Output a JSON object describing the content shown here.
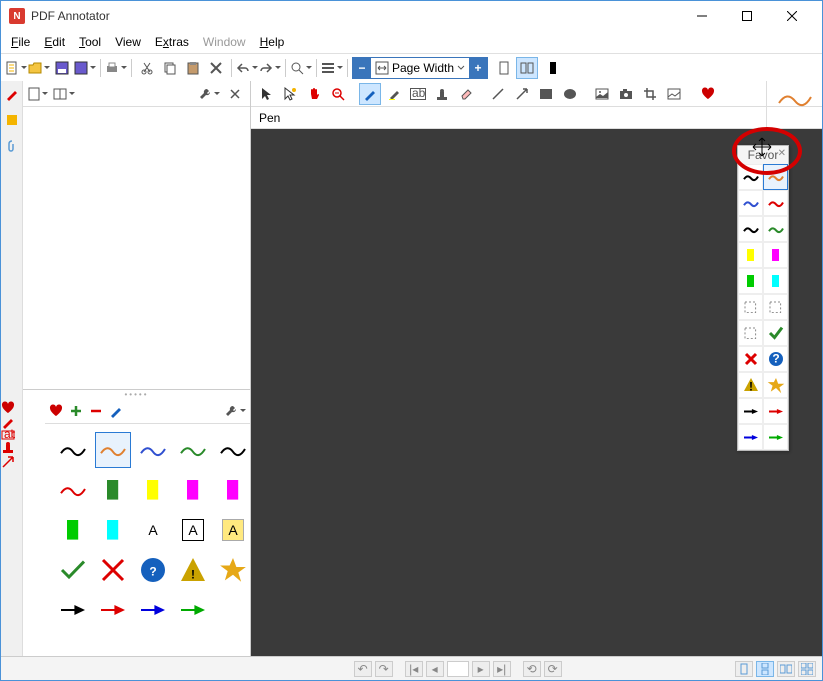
{
  "window": {
    "title": "PDF Annotator",
    "app_abbrev": "N"
  },
  "menu": {
    "file": "File",
    "file_u": "F",
    "edit": "Edit",
    "edit_u": "E",
    "tool": "Tool",
    "tool_u": "T",
    "view": "View",
    "view_u": "V",
    "extras": "Extras",
    "extras_u": "x",
    "window": "Window",
    "window_u": "W",
    "help": "Help",
    "help_u": "H"
  },
  "zoom": {
    "label": "Page Width"
  },
  "tooltabs": {
    "current_label": "Pen"
  },
  "favorites_panel": {
    "title": "Favor"
  },
  "left_tabs": {
    "items": [
      {
        "name": "marker",
        "color": "#d40000"
      },
      {
        "name": "note",
        "color": "#f4b400"
      },
      {
        "name": "attach",
        "color": "#5a9bd5"
      }
    ]
  },
  "fav_hdr": {
    "icons": [
      "heart",
      "plus",
      "minus",
      "pencil"
    ]
  },
  "fav_grid_items": [
    {
      "t": "sq",
      "c": "#000"
    },
    {
      "t": "sq",
      "c": "#e08030",
      "sel": true
    },
    {
      "t": "sq",
      "c": "#3050d0"
    },
    {
      "t": "sq",
      "c": "#2a8a2a"
    },
    {
      "t": "sq",
      "c": "#000"
    },
    {
      "t": "sq",
      "c": "#d00"
    },
    {
      "t": "hl",
      "c": "#2a8a2a"
    },
    {
      "t": "hl",
      "c": "#ff0"
    },
    {
      "t": "hl",
      "c": "#f0f"
    },
    {
      "t": "hl",
      "c": "#f0f"
    },
    {
      "t": "hl",
      "c": "#0c0"
    },
    {
      "t": "hl",
      "c": "#0ff"
    },
    {
      "t": "tx",
      "c": "#000",
      "bg": "#fff",
      "bd": "#fff"
    },
    {
      "t": "tx",
      "c": "#000",
      "bg": "#fff",
      "bd": "#000"
    },
    {
      "t": "tx",
      "c": "#000",
      "bg": "#ffe97f",
      "bd": "#aaa"
    },
    {
      "t": "ck",
      "c": "#2a8a2a"
    },
    {
      "t": "xm",
      "c": "#d00"
    },
    {
      "t": "qc",
      "c": "#1560bd"
    },
    {
      "t": "wr",
      "c": "#caa200"
    },
    {
      "t": "st",
      "c": "#e6a817"
    },
    {
      "t": "ar",
      "c": "#000"
    },
    {
      "t": "ar",
      "c": "#d00"
    },
    {
      "t": "ar",
      "c": "#00d"
    },
    {
      "t": "ar",
      "c": "#0a0"
    },
    {
      "t": "",
      "c": ""
    }
  ],
  "float_items": [
    {
      "t": "sq",
      "c": "#000"
    },
    {
      "t": "sq",
      "c": "#e08030",
      "sel": true
    },
    {
      "t": "sq",
      "c": "#3050d0"
    },
    {
      "t": "sq",
      "c": "#d00"
    },
    {
      "t": "sq",
      "c": "#000"
    },
    {
      "t": "sq",
      "c": "#2a8a2a"
    },
    {
      "t": "hl",
      "c": "#ff0"
    },
    {
      "t": "hl",
      "c": "#f0f"
    },
    {
      "t": "hl",
      "c": "#0c0"
    },
    {
      "t": "hl",
      "c": "#0ff"
    },
    {
      "t": "bx",
      "c": "#888"
    },
    {
      "t": "bx",
      "c": "#888"
    },
    {
      "t": "bx",
      "c": "#888"
    },
    {
      "t": "ck",
      "c": "#2a8a2a"
    },
    {
      "t": "xm",
      "c": "#d00"
    },
    {
      "t": "qc",
      "c": "#1560bd"
    },
    {
      "t": "wr",
      "c": "#caa200"
    },
    {
      "t": "st",
      "c": "#e6a817"
    },
    {
      "t": "ar",
      "c": "#000"
    },
    {
      "t": "ar",
      "c": "#d00"
    },
    {
      "t": "ar",
      "c": "#00d"
    },
    {
      "t": "ar",
      "c": "#0a0"
    }
  ],
  "left_tool_strip": [
    {
      "name": "heart",
      "c": "#c00"
    },
    {
      "name": "pen",
      "c": "#d00"
    },
    {
      "name": "text-box",
      "c": "#d00"
    },
    {
      "name": "stamp",
      "c": "#d00"
    },
    {
      "name": "arrow",
      "c": "#d00"
    }
  ],
  "colors": {
    "accent": "#e08030",
    "canvas": "#3a3a3a"
  }
}
